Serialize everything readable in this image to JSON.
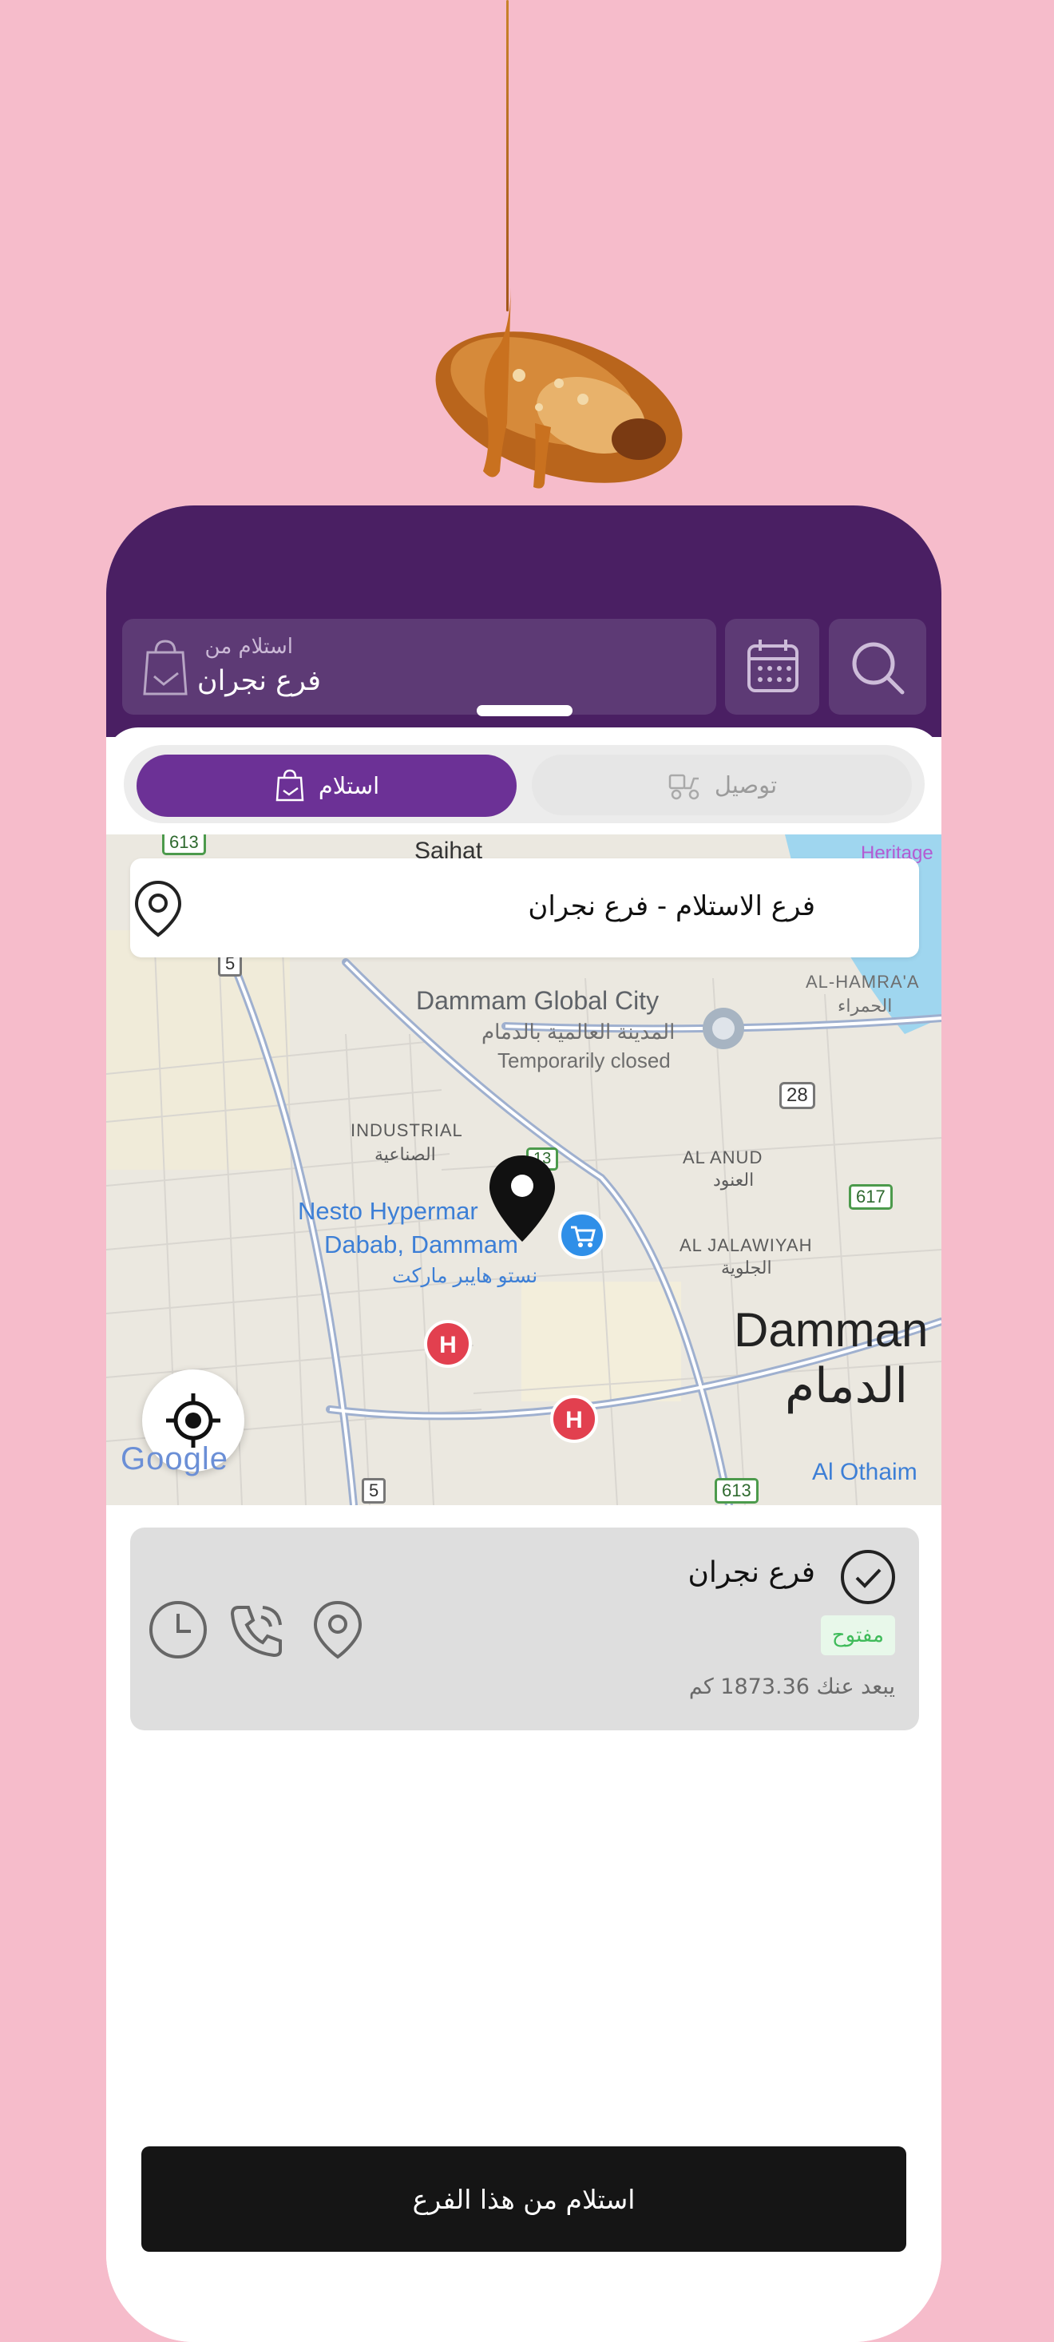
{
  "header": {
    "pickup_label": "استلام من",
    "pickup_value": "فرع نجران"
  },
  "order_type": {
    "delivery_label": "توصيل",
    "pickup_label": "استلام",
    "selected": "pickup"
  },
  "map": {
    "banner_text": "فرع الاستلام - فرع نجران",
    "labels": {
      "saihat": "Saihat",
      "heritage": "Heritage",
      "global_city_en": "Dammam Global City",
      "global_city_ar": "المدينة العالمية بالدمام",
      "temporarily_closed": "Temporarily closed",
      "alhamra_en": "AL-HAMRA'A",
      "alhamra_ar": "الحمراء",
      "industrial_en": "INDUSTRIAL",
      "industrial_ar": "الصناعية",
      "alanud_en": "AL ANUD",
      "alanud_ar": "العنود",
      "aljalawiyah_en": "AL JALAWIYAH",
      "aljalawiyah_ar": "الجلوية",
      "nesto_line1": "Nesto Hypermar",
      "nesto_line2": "Dabab, Dammam",
      "nesto_ar": "نستو هايبر ماركت",
      "dammam_en": "Damman",
      "dammam_ar": "الدمام",
      "othaim": "Al Othaim",
      "road_613_top": "613",
      "road_5_top": "5",
      "road_28": "28",
      "road_617": "617",
      "road_613_bottom": "613",
      "road_5_bottom": "5",
      "road_13": "13",
      "google": "Google"
    },
    "accent_blue": "#3d7fd6",
    "water": "#9fd6ef"
  },
  "branch": {
    "name": "فرع نجران",
    "status": "مفتوح",
    "distance": "يبعد عنك 1873.36 كم",
    "status_color": "#3fbb5a"
  },
  "cta_label": "استلام من هذا الفرع",
  "colors": {
    "background": "#f6bccb",
    "header": "#4a1f63",
    "accent": "#6c3196"
  }
}
